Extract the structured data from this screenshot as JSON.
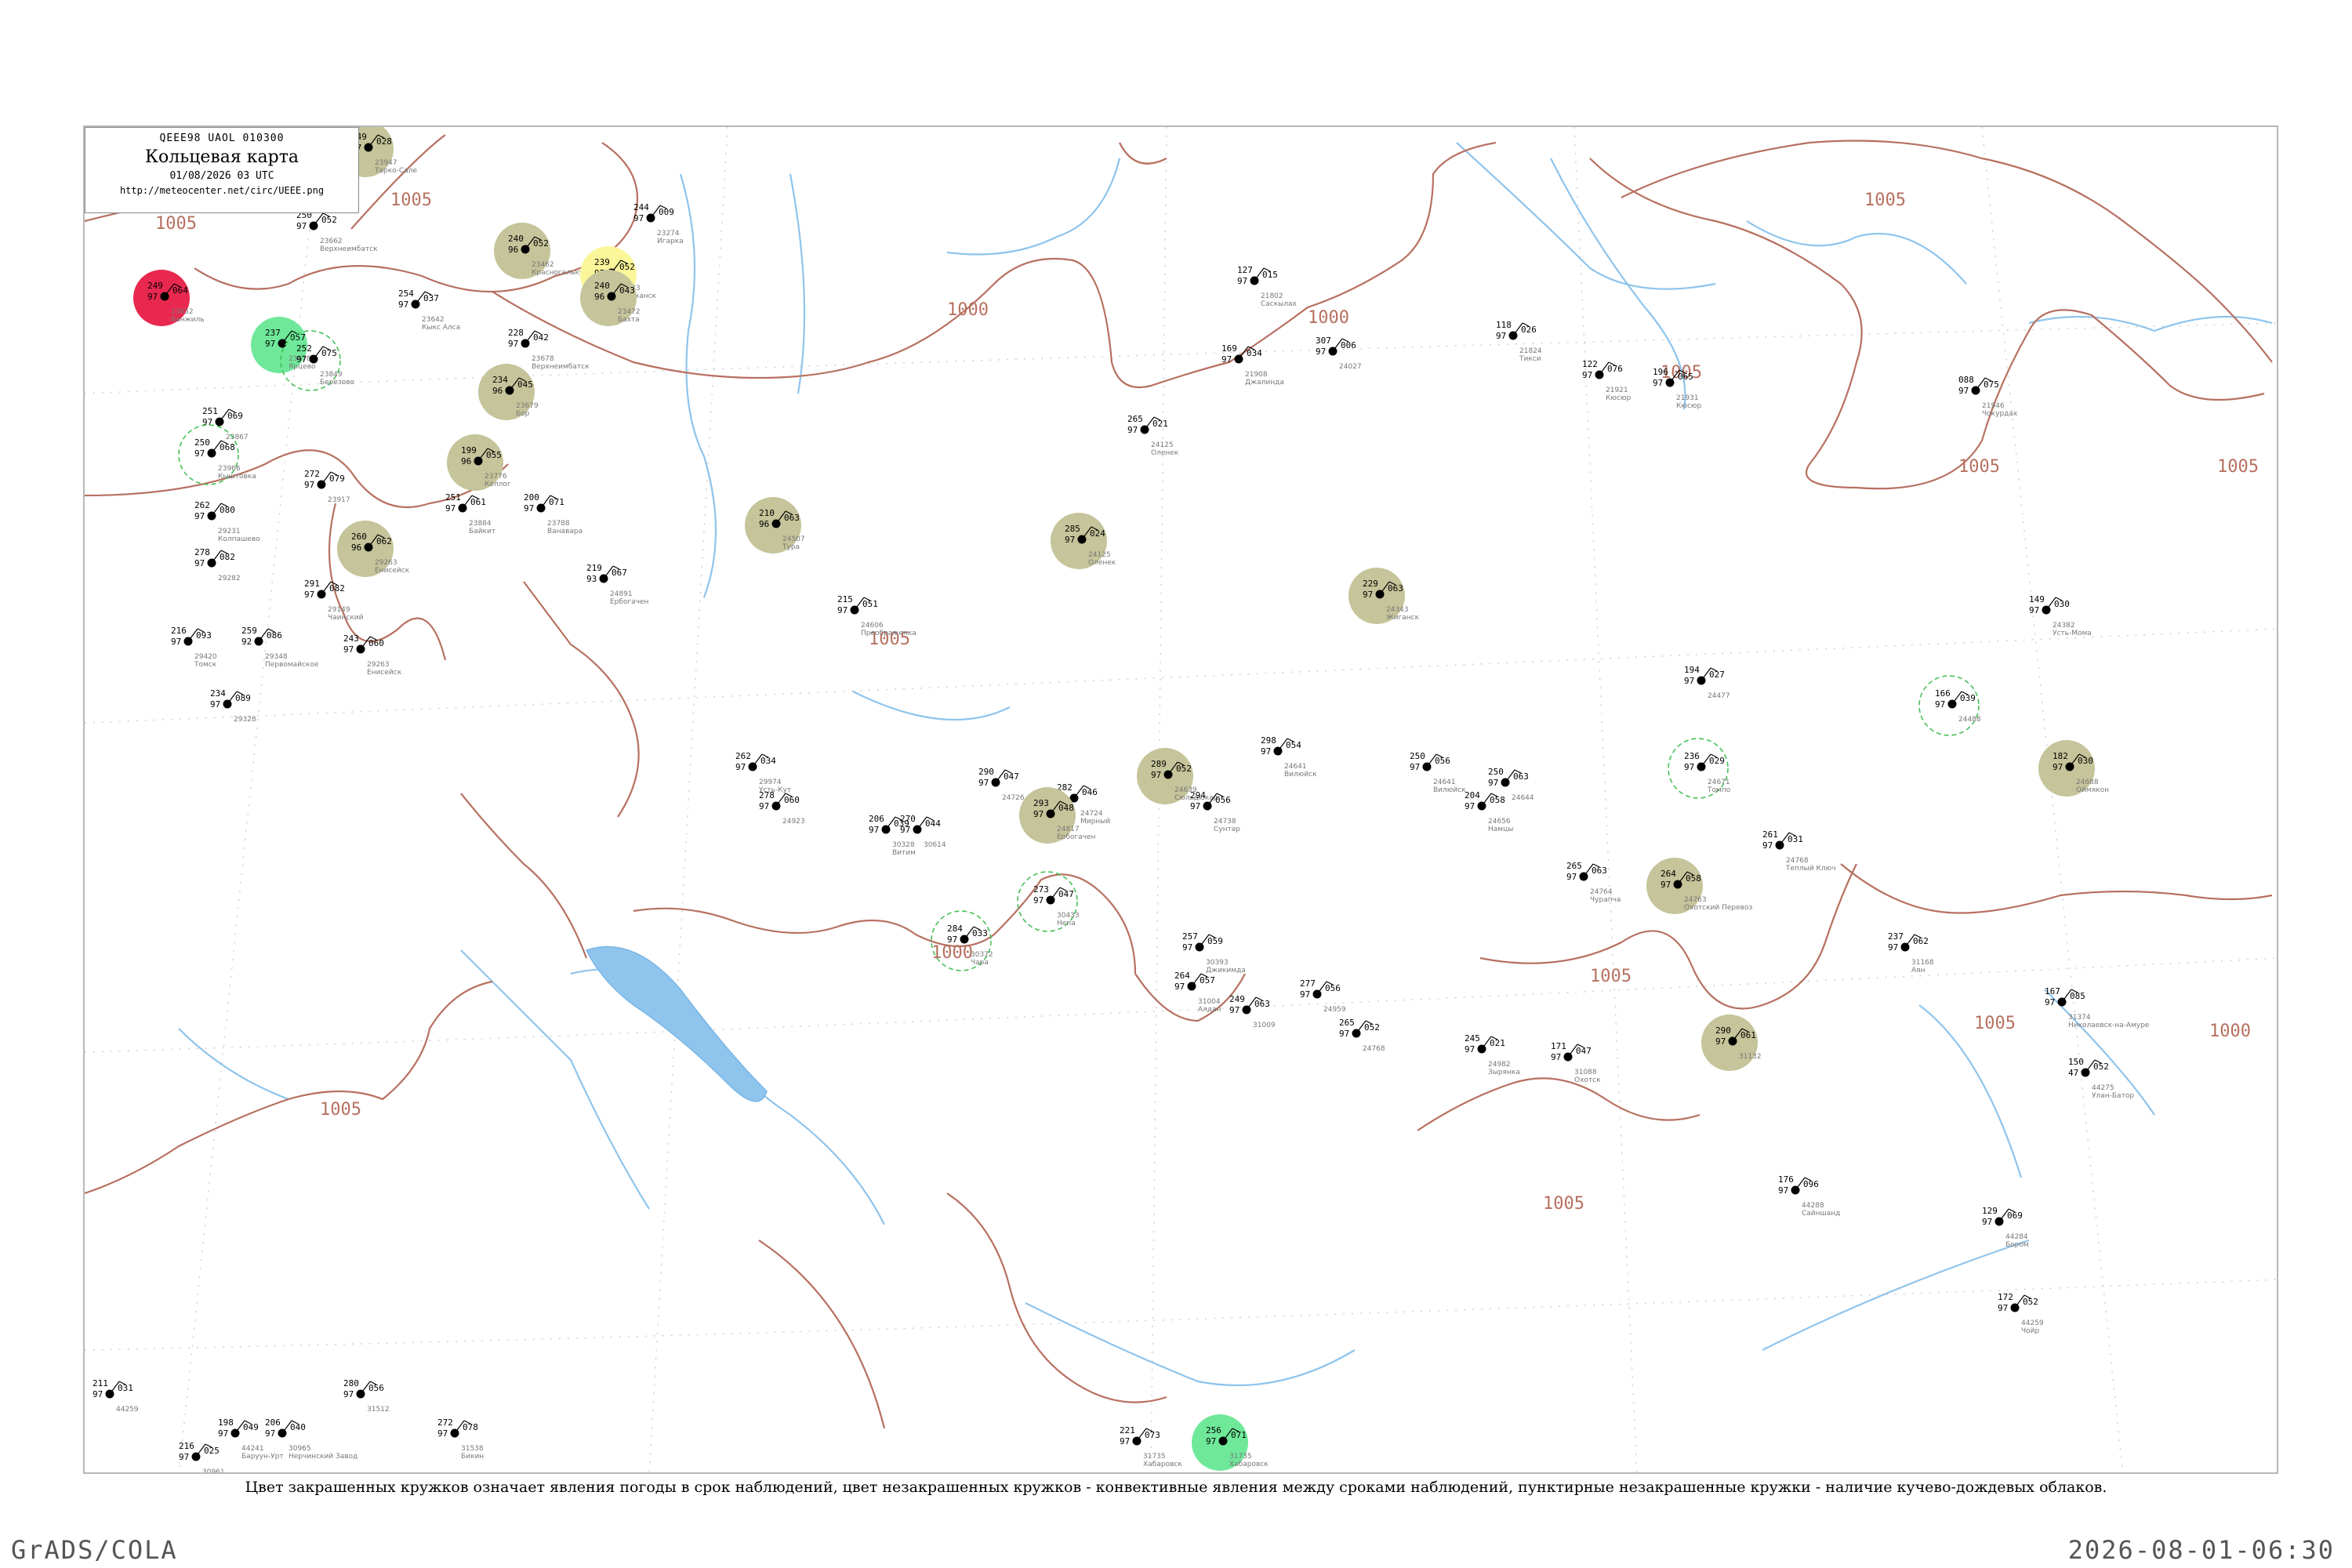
{
  "title_box": {
    "code": "QEEE98  UAOL  010300",
    "title": "Кольцевая карта",
    "datetime": "01/08/2026 03 UTC",
    "url": "http://meteocenter.net/circ/UEEE.png"
  },
  "isobars": [
    "1005",
    "1000",
    "1005",
    "1005",
    "1000",
    "1005",
    "1005",
    "1005",
    "1005",
    "1000",
    "1005",
    "1005",
    "1000",
    "1005",
    "1005"
  ],
  "colors": {
    "contour": "#b77060",
    "water": "#8fc4ec",
    "rain": "#0bbf2a",
    "light_rain": "#6fe89a",
    "thunder": "#e8284f",
    "fog": "#fff81c",
    "haze": "#fbf69a",
    "dust": "#c5c49a",
    "cb_ring": "#48c05a"
  },
  "stations": [
    {
      "p": "052",
      "t": "250",
      "n": "97",
      "id": "23662",
      "name": "Верхнеимбатск"
    },
    {
      "p": "064",
      "t": "249",
      "n": "97",
      "id": "23652",
      "name": "Ванжиль"
    },
    {
      "p": "057",
      "t": "237",
      "n": "97",
      "id": "23678",
      "name": "Ярцево"
    },
    {
      "p": "075",
      "t": "252",
      "n": "97",
      "id": "23849",
      "name": "Березово"
    },
    {
      "p": "069",
      "t": "251",
      "n": "97",
      "id": "23867",
      "name": ""
    },
    {
      "p": "068",
      "t": "250",
      "n": "97",
      "id": "23966",
      "name": "Кыштовка"
    },
    {
      "p": "079",
      "t": "272",
      "n": "97",
      "id": "23917",
      "name": ""
    },
    {
      "p": "080",
      "t": "262",
      "n": "97",
      "id": "29231",
      "name": "Колпашево"
    },
    {
      "p": "082",
      "t": "278",
      "n": "97",
      "id": "29282",
      "name": ""
    },
    {
      "p": "082",
      "t": "291",
      "n": "97",
      "id": "29149",
      "name": "Чаинский"
    },
    {
      "p": "093",
      "t": "216",
      "n": "97",
      "id": "29420",
      "name": "Томск"
    },
    {
      "p": "086",
      "t": "259",
      "n": "92",
      "id": "29348",
      "name": "Первомайское"
    },
    {
      "p": "089",
      "t": "234",
      "n": "97",
      "id": "29328",
      "name": ""
    },
    {
      "p": "028",
      "t": "249",
      "n": "97",
      "id": "23947",
      "name": "Тарко-Сале"
    },
    {
      "p": "052",
      "t": "240",
      "n": "96",
      "id": "23462",
      "name": "Красноселькуп"
    },
    {
      "p": "009",
      "t": "244",
      "n": "97",
      "id": "23274",
      "name": "Игарка"
    },
    {
      "p": "052",
      "t": "239",
      "n": "97",
      "id": "23383",
      "name": "Туруханск"
    },
    {
      "p": "043",
      "t": "240",
      "n": "96",
      "id": "23472",
      "name": "Бахта"
    },
    {
      "p": "037",
      "t": "254",
      "n": "97",
      "id": "23642",
      "name": "Кыкс Алса"
    },
    {
      "p": "042",
      "t": "228",
      "n": "97",
      "id": "23678",
      "name": "Верхнеимбатск"
    },
    {
      "p": "045",
      "t": "234",
      "n": "96",
      "id": "23679",
      "name": "Бор"
    },
    {
      "p": "055",
      "t": "199",
      "n": "96",
      "id": "23776",
      "name": "Келлог"
    },
    {
      "p": "061",
      "t": "251",
      "n": "97",
      "id": "23884",
      "name": "Байкит"
    },
    {
      "p": "071",
      "t": "200",
      "n": "97",
      "id": "23788",
      "name": "Ванавара"
    },
    {
      "p": "062",
      "t": "260",
      "n": "96",
      "id": "29263",
      "name": "Енисейск"
    },
    {
      "p": "067",
      "t": "219",
      "n": "93",
      "id": "24891",
      "name": "Ербогачен"
    },
    {
      "p": "060",
      "t": "243",
      "n": "97",
      "id": "29263",
      "name": "Енисейск"
    },
    {
      "p": "051",
      "t": "215",
      "n": "97",
      "id": "24606",
      "name": "Преображенка"
    },
    {
      "p": "063",
      "t": "210",
      "n": "96",
      "id": "24507",
      "name": "Тура"
    },
    {
      "p": "024",
      "t": "285",
      "n": "97",
      "id": "24125",
      "name": "Оленек"
    },
    {
      "p": "063",
      "t": "229",
      "n": "97",
      "id": "24343",
      "name": "Жиганск"
    },
    {
      "p": "015",
      "t": "127",
      "n": "97",
      "id": "21802",
      "name": "Саскылах"
    },
    {
      "p": "034",
      "t": "169",
      "n": "97",
      "id": "21908",
      "name": "Джалинда"
    },
    {
      "p": "021",
      "t": "265",
      "n": "97",
      "id": "24125",
      "name": "Оленек"
    },
    {
      "p": "006",
      "t": "307",
      "n": "97",
      "id": "24027",
      "name": ""
    },
    {
      "p": "076",
      "t": "122",
      "n": "97",
      "id": "21921",
      "name": "Кюсюр"
    },
    {
      "p": "026",
      "t": "118",
      "n": "97",
      "id": "21824",
      "name": "Тикси"
    },
    {
      "p": "065",
      "t": "196",
      "n": "97",
      "id": "21931",
      "name": "Кюсюр"
    },
    {
      "p": "075",
      "t": "088",
      "n": "97",
      "id": "21946",
      "name": "Чокурдах"
    },
    {
      "p": "030",
      "t": "149",
      "n": "97",
      "id": "24382",
      "name": "Усть-Мома"
    },
    {
      "p": "027",
      "t": "194",
      "n": "97",
      "id": "24477",
      "name": ""
    },
    {
      "p": "039",
      "t": "166",
      "n": "97",
      "id": "24488",
      "name": ""
    },
    {
      "p": "030",
      "t": "182",
      "n": "97",
      "id": "24688",
      "name": "Оймякон"
    },
    {
      "p": "029",
      "t": "236",
      "n": "97",
      "id": "24671",
      "name": "Томпо"
    },
    {
      "p": "031",
      "t": "261",
      "n": "97",
      "id": "24768",
      "name": "Теплый Ключ"
    },
    {
      "p": "058",
      "t": "264",
      "n": "97",
      "id": "24763",
      "name": "Охотский Перевоз"
    },
    {
      "p": "063",
      "t": "265",
      "n": "97",
      "id": "24764",
      "name": "Чурапча"
    },
    {
      "p": "056",
      "t": "250",
      "n": "97",
      "id": "24641",
      "name": "Вилюйск"
    },
    {
      "p": "063",
      "t": "250",
      "n": "97",
      "id": "24644",
      "name": ""
    },
    {
      "p": "058",
      "t": "204",
      "n": "97",
      "id": "24656",
      "name": "Намцы"
    },
    {
      "p": "054",
      "t": "298",
      "n": "97",
      "id": "24641",
      "name": "Вилюйск"
    },
    {
      "p": "052",
      "t": "289",
      "n": "97",
      "id": "24639",
      "name": "Сюльдюкар"
    },
    {
      "p": "056",
      "t": "294",
      "n": "97",
      "id": "24738",
      "name": "Сунтар"
    },
    {
      "p": "046",
      "t": "282",
      "n": "97",
      "id": "24724",
      "name": "Мирный"
    },
    {
      "p": "047",
      "t": "290",
      "n": "97",
      "id": "24726",
      "name": ""
    },
    {
      "p": "048",
      "t": "293",
      "n": "97",
      "id": "24817",
      "name": "Ербогачен"
    },
    {
      "p": "044",
      "t": "270",
      "n": "97",
      "id": "30614",
      "name": ""
    },
    {
      "p": "034",
      "t": "262",
      "n": "97",
      "id": "29974",
      "name": "Усть-Кут"
    },
    {
      "p": "060",
      "t": "278",
      "n": "97",
      "id": "24923",
      "name": ""
    },
    {
      "p": "039",
      "t": "206",
      "n": "97",
      "id": "30328",
      "name": "Витим"
    },
    {
      "p": "047",
      "t": "273",
      "n": "97",
      "id": "30433",
      "name": "Непа"
    },
    {
      "p": "033",
      "t": "284",
      "n": "97",
      "id": "30372",
      "name": "Чара"
    },
    {
      "p": "059",
      "t": "257",
      "n": "97",
      "id": "30393",
      "name": "Джикимда"
    },
    {
      "p": "057",
      "t": "264",
      "n": "97",
      "id": "31004",
      "name": "Алдан"
    },
    {
      "p": "063",
      "t": "249",
      "n": "97",
      "id": "31009",
      "name": ""
    },
    {
      "p": "056",
      "t": "277",
      "n": "97",
      "id": "24959",
      "name": ""
    },
    {
      "p": "052",
      "t": "265",
      "n": "97",
      "id": "24768",
      "name": ""
    },
    {
      "p": "021",
      "t": "245",
      "n": "97",
      "id": "24982",
      "name": "Зырянка"
    },
    {
      "p": "047",
      "t": "171",
      "n": "97",
      "id": "31088",
      "name": "Охотск"
    },
    {
      "p": "061",
      "t": "290",
      "n": "97",
      "id": "31132",
      "name": ""
    },
    {
      "p": "062",
      "t": "237",
      "n": "97",
      "id": "31168",
      "name": "Аян"
    },
    {
      "p": "085",
      "t": "167",
      "n": "97",
      "id": "31374",
      "name": "Николаевск-на-Амуре"
    },
    {
      "p": "052",
      "t": "150",
      "n": "47",
      "id": "44275",
      "name": "Улан-Батор"
    },
    {
      "p": "096",
      "t": "176",
      "n": "97",
      "id": "44288",
      "name": "Сайншанд"
    },
    {
      "p": "069",
      "t": "129",
      "n": "97",
      "id": "44284",
      "name": "Бором"
    },
    {
      "p": "052",
      "t": "172",
      "n": "97",
      "id": "44259",
      "name": "Чойр"
    },
    {
      "p": "031",
      "t": "211",
      "n": "97",
      "id": "44259",
      "name": ""
    },
    {
      "p": "049",
      "t": "198",
      "n": "97",
      "id": "44241",
      "name": "Баруун-Урт"
    },
    {
      "p": "025",
      "t": "216",
      "n": "97",
      "id": "30961",
      "name": "Борзя"
    },
    {
      "p": "040",
      "t": "206",
      "n": "97",
      "id": "30965",
      "name": "Нерчинский Завод"
    },
    {
      "p": "056",
      "t": "280",
      "n": "97",
      "id": "31512",
      "name": ""
    },
    {
      "p": "078",
      "t": "272",
      "n": "97",
      "id": "31538",
      "name": "Бикин"
    },
    {
      "p": "073",
      "t": "221",
      "n": "97",
      "id": "31735",
      "name": "Хабаровск"
    },
    {
      "p": "071",
      "t": "256",
      "n": "97",
      "id": "31735",
      "name": "Хабаровск"
    }
  ],
  "caption": "Цвет закрашенных кружков означает явления погоды в срок наблюдений, цвет незакрашенных кружков - конвективные явления между сроками наблюдений, пунктирные незакрашенные кружки - наличие кучево-дождевых облаков.",
  "footer": {
    "left": "GrADS/COLA",
    "right": "2026-08-01-06:30"
  }
}
